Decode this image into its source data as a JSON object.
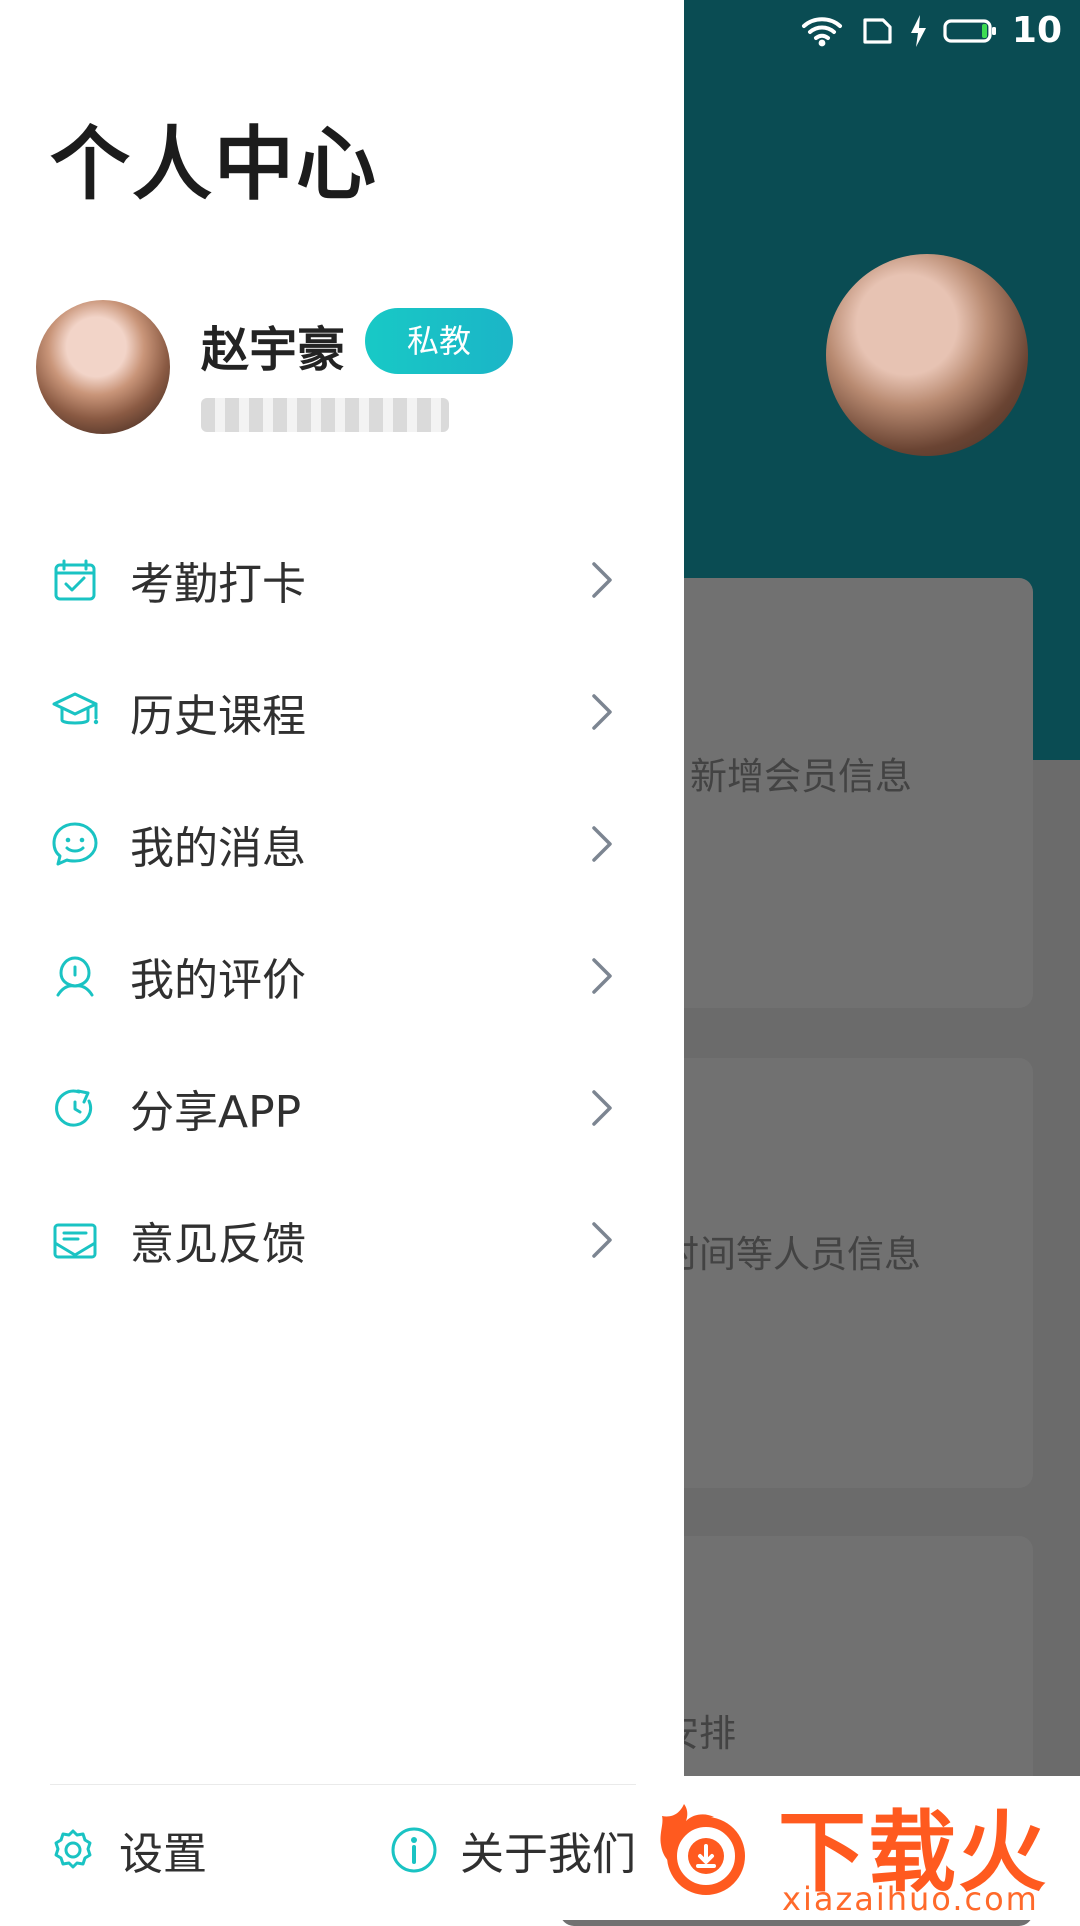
{
  "status_bar": {
    "battery_text": "10",
    "icons": [
      "wifi-icon",
      "sim-icon",
      "charging-icon",
      "battery-icon"
    ]
  },
  "drawer": {
    "title": "个人中心",
    "profile": {
      "name": "赵宇豪",
      "badge": "私教"
    },
    "menu": [
      {
        "label": "考勤打卡",
        "icon": "calendar-check-icon"
      },
      {
        "label": "历史课程",
        "icon": "graduation-cap-icon"
      },
      {
        "label": "我的消息",
        "icon": "chat-bubble-icon"
      },
      {
        "label": "我的评价",
        "icon": "flower-icon"
      },
      {
        "label": "分享APP",
        "icon": "share-refresh-icon"
      },
      {
        "label": "意见反馈",
        "icon": "feedback-envelope-icon"
      }
    ],
    "footer": {
      "settings_label": "设置",
      "about_label": "关于我们"
    }
  },
  "background_page": {
    "card_texts": [
      "新增会员信息",
      "时间等人员信息",
      "安排"
    ]
  },
  "watermark": {
    "brand": "下载火",
    "domain": "xiazaihuo.com"
  },
  "colors": {
    "accent": "#19C2C3",
    "header_bg": "#0A4C53",
    "overlay_bg": "#6B6B6B"
  }
}
